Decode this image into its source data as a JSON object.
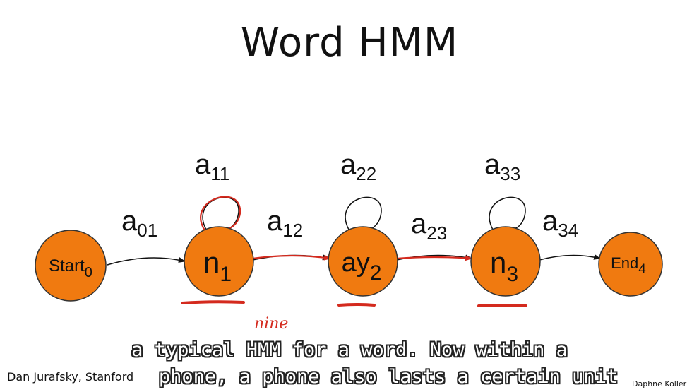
{
  "title": "Word HMM",
  "states": [
    {
      "id": "start",
      "base": "Start",
      "sub": "0",
      "color": "#f07a10"
    },
    {
      "id": "n1",
      "base": "n",
      "sub": "1",
      "color": "#f07a10"
    },
    {
      "id": "ay2",
      "base": "ay",
      "sub": "2",
      "color": "#f07a10"
    },
    {
      "id": "n3",
      "base": "n",
      "sub": "3",
      "color": "#f07a10"
    },
    {
      "id": "end",
      "base": "End",
      "sub": "4",
      "color": "#f07a10"
    }
  ],
  "transitions": [
    {
      "base": "a",
      "sub": "01"
    },
    {
      "base": "a",
      "sub": "12"
    },
    {
      "base": "a",
      "sub": "23"
    },
    {
      "base": "a",
      "sub": "34"
    }
  ],
  "self_loops": [
    {
      "base": "a",
      "sub": "11"
    },
    {
      "base": "a",
      "sub": "22"
    },
    {
      "base": "a",
      "sub": "33"
    }
  ],
  "annotation": "nine",
  "annotation_color": "#d42a1e",
  "credits": {
    "left": "Dan Jurafsky, Stanford",
    "right": "Daphne Koller"
  },
  "caption": {
    "line1": "a typical HMM for a word. Now within a",
    "line2": "phone, a phone also lasts a certain unit"
  }
}
